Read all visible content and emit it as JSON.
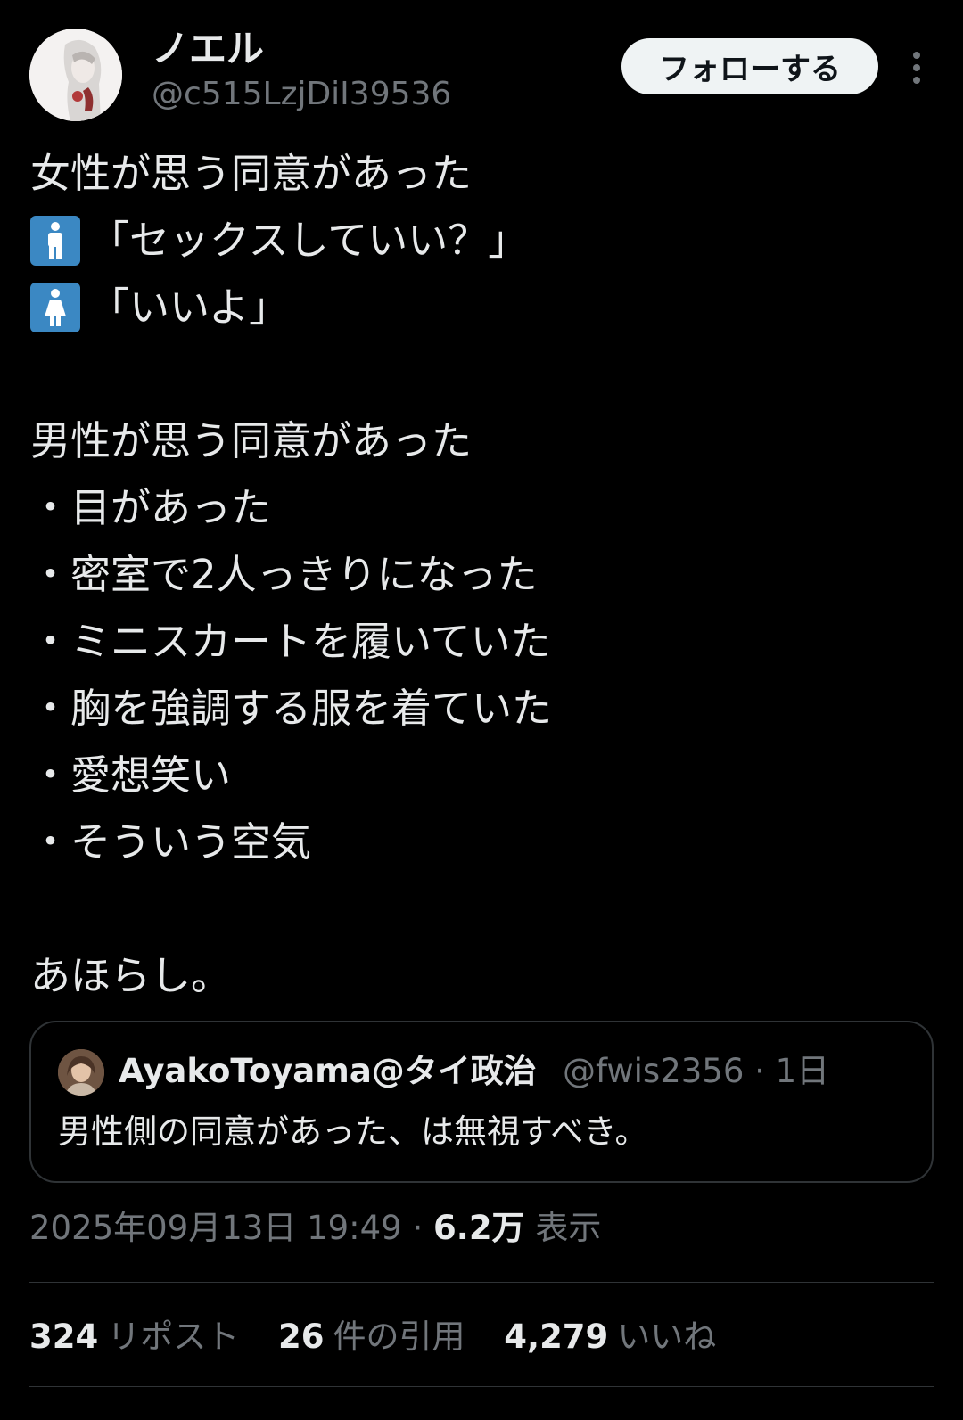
{
  "author": {
    "display_name": "ノエル",
    "handle": "@c515LzjDiI39536",
    "avatar_icon": "illustrated-character-avatar"
  },
  "header": {
    "follow_label": "フォローする",
    "more_icon": "vertical-ellipsis-icon"
  },
  "tweet": {
    "line_1": "女性が思う同意があった",
    "line_2_text": "「セックスしていい？」",
    "line_2_icon": "mens-room-emoji-icon",
    "line_3_text": "「いいよ」",
    "line_3_icon": "womens-room-emoji-icon",
    "line_5": "男性が思う同意があった",
    "bullets": [
      "・目があった",
      "・密室で2人っきりになった",
      "・ミニスカートを履いていた",
      "・胸を強調する服を着ていた",
      "・愛想笑い",
      "・そういう空気"
    ],
    "closing": "あほらし。"
  },
  "quote": {
    "name": "AyakoToyama@タイ政治",
    "handle_time": "@fwis2356 · 1日",
    "text": "男性側の同意があった、は無視すべき。"
  },
  "meta": {
    "timestamp": "2025年09月13日 19:49",
    "separator": " · ",
    "views_count": "6.2万",
    "views_label": "表示"
  },
  "stats": {
    "reposts_count": "324",
    "reposts_label": "リポスト",
    "quotes_count": "26",
    "quotes_label": "件の引用",
    "likes_count": "4,279",
    "likes_label": "いいね"
  },
  "colors": {
    "background": "#000000",
    "text_primary": "#e7e9ea",
    "text_secondary": "#71767b",
    "border": "#2f3336",
    "emoji_blue": "#3b88c3",
    "follow_button_bg": "#eff3f4"
  }
}
